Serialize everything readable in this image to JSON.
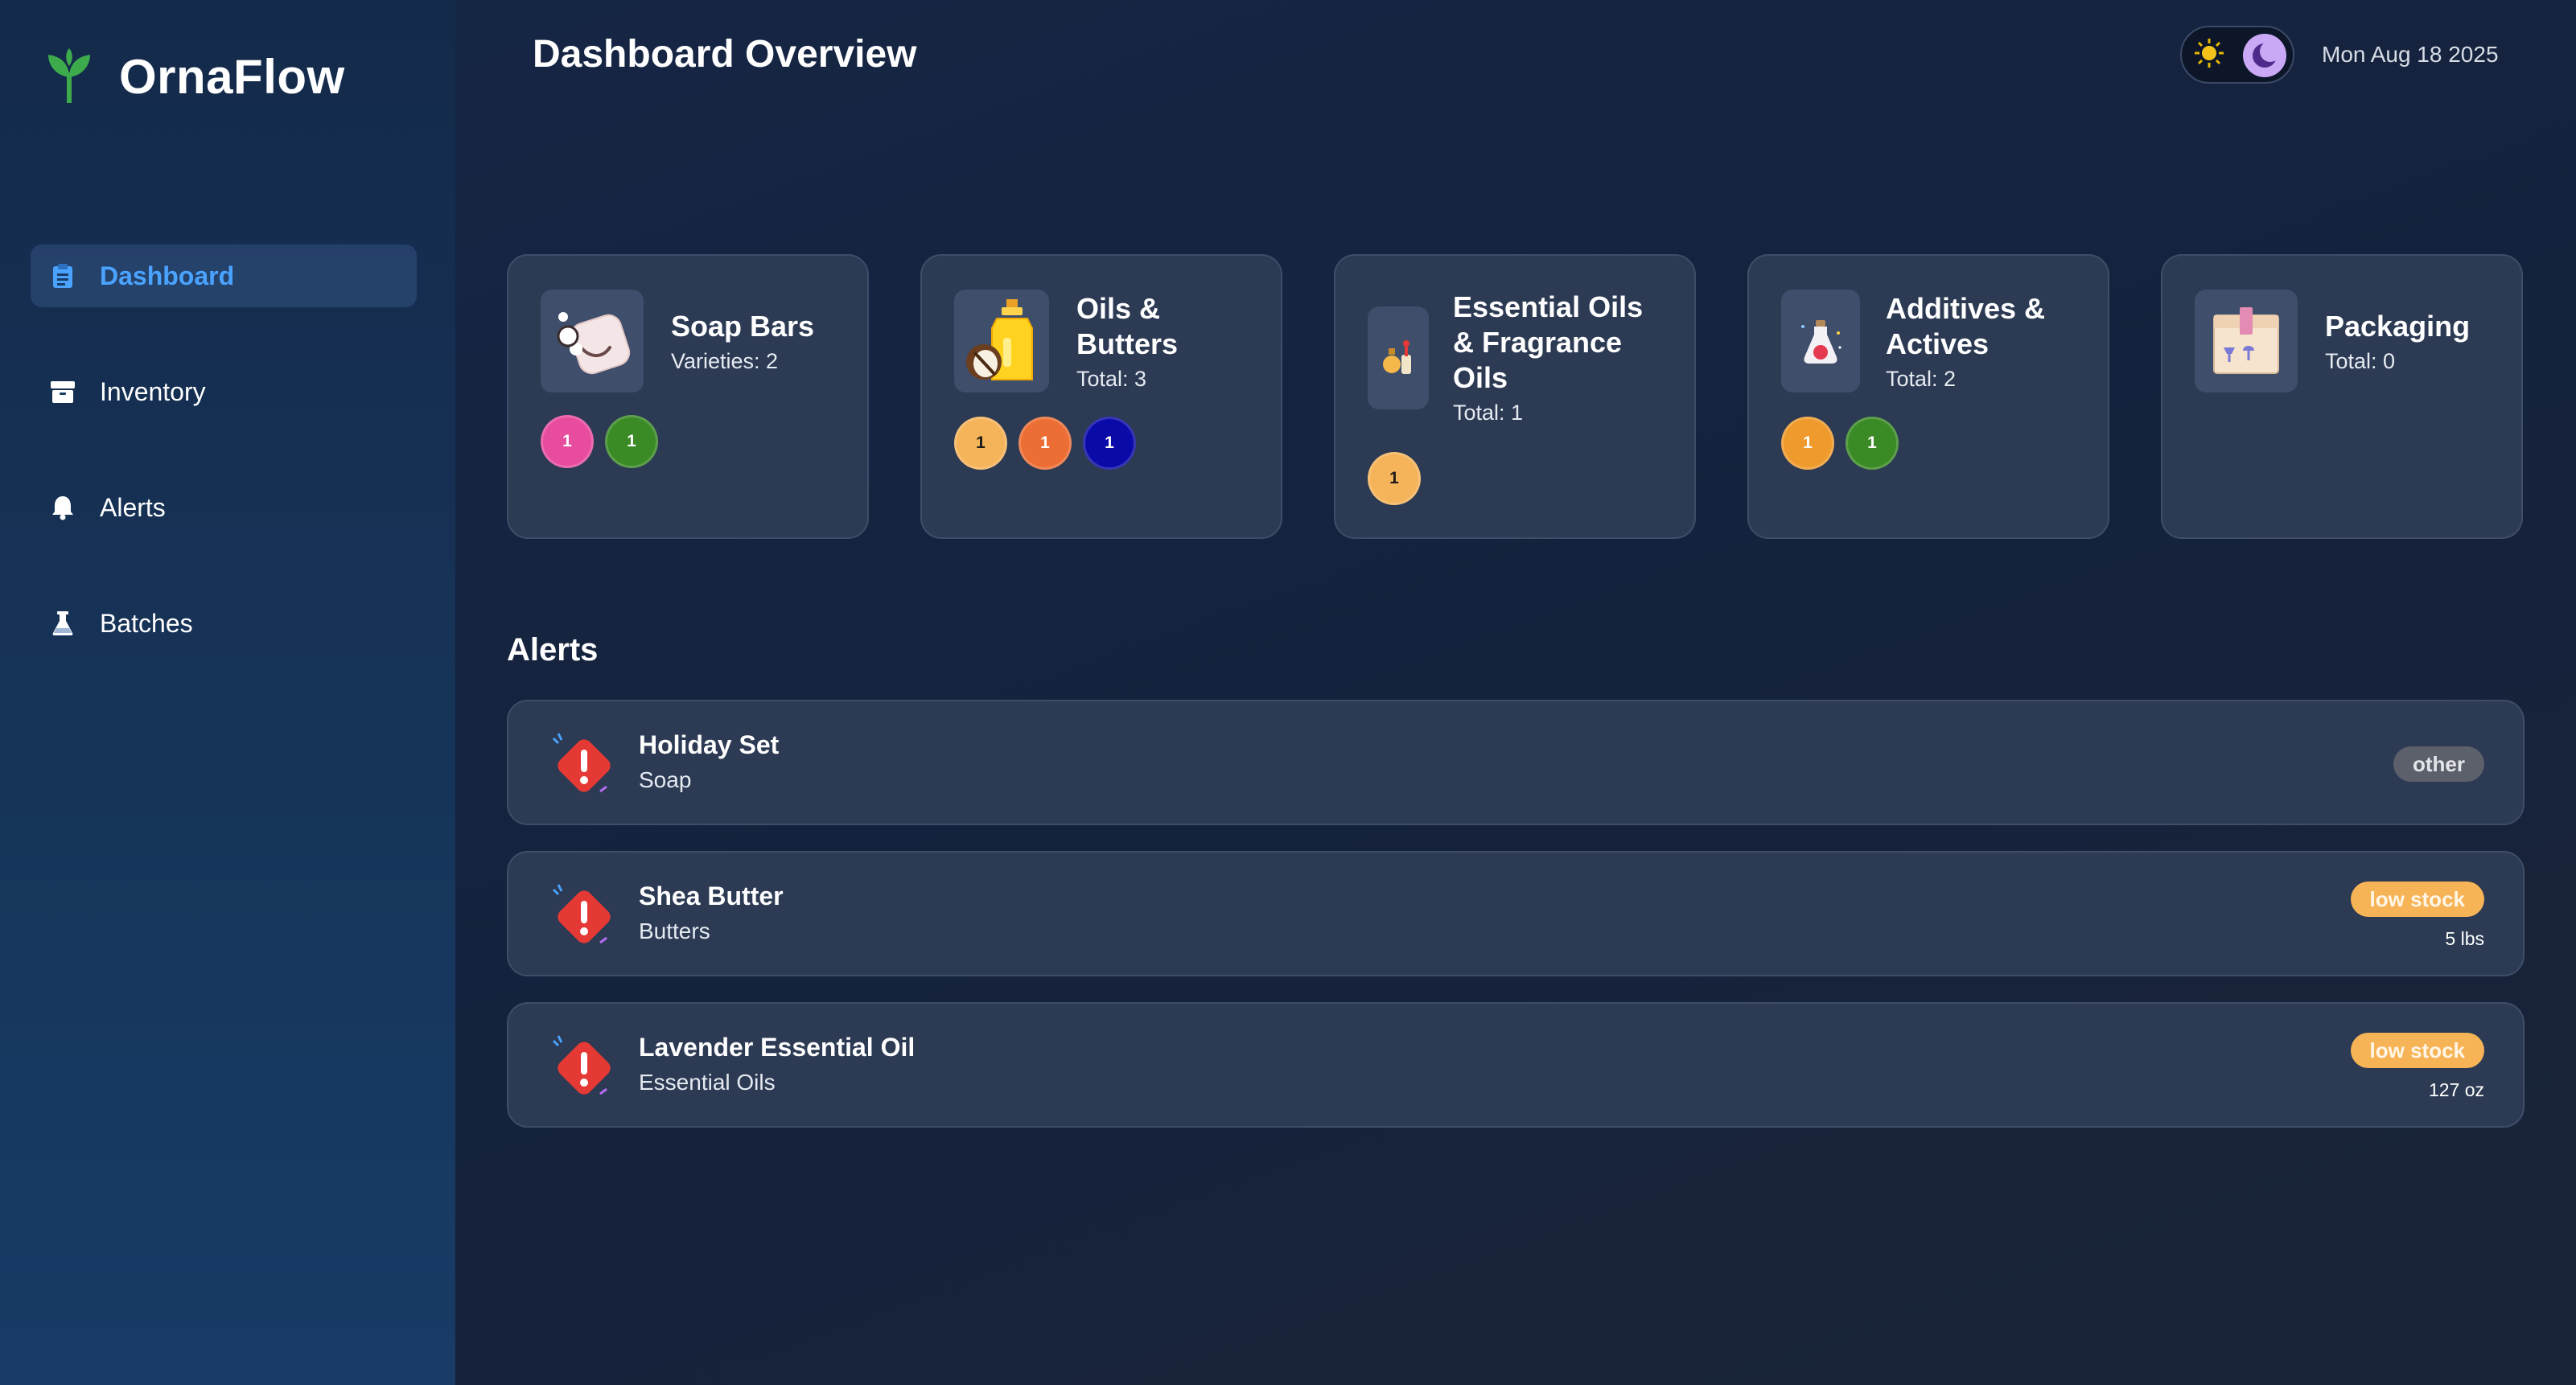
{
  "app": {
    "name": "OrnaFlow"
  },
  "nav": {
    "items": [
      {
        "label": "Dashboard",
        "icon": "clipboard-icon",
        "active": true
      },
      {
        "label": "Inventory",
        "icon": "box-icon",
        "active": false
      },
      {
        "label": "Alerts",
        "icon": "bell-icon",
        "active": false
      },
      {
        "label": "Batches",
        "icon": "flask-icon",
        "active": false
      }
    ]
  },
  "header": {
    "title": "Dashboard Overview",
    "date": "Mon Aug 18 2025",
    "theme": "dark"
  },
  "categories": [
    {
      "title": "Soap Bars",
      "sub": "Varieties: 2",
      "icon": "soap-icon",
      "badges": [
        {
          "value": "1",
          "color": "#e84c9e"
        },
        {
          "value": "1",
          "color": "#3a8a25"
        }
      ]
    },
    {
      "title": "Oils & Butters",
      "sub": "Total: 3",
      "icon": "oil-bottle-coconut-icon",
      "badges": [
        {
          "value": "1",
          "color": "#f5b459"
        },
        {
          "value": "1",
          "color": "#ec6e34"
        },
        {
          "value": "1",
          "color": "#0a0aa8"
        }
      ]
    },
    {
      "title": "Essential Oils & Fragrance Oils",
      "sub": "Total: 1",
      "icon": "perfume-icon",
      "badges": [
        {
          "value": "1",
          "color": "#f5b459"
        }
      ]
    },
    {
      "title": "Additives & Actives",
      "sub": "Total: 2",
      "icon": "potion-icon",
      "badges": [
        {
          "value": "1",
          "color": "#ef9a2c"
        },
        {
          "value": "1",
          "color": "#3a8a25"
        }
      ]
    },
    {
      "title": "Packaging",
      "sub": "Total: 0",
      "icon": "package-box-icon",
      "badges": []
    }
  ],
  "alerts": {
    "title": "Alerts",
    "items": [
      {
        "name": "Holiday Set",
        "category": "Soap",
        "status": "other",
        "qty": ""
      },
      {
        "name": "Shea Butter",
        "category": "Butters",
        "status": "low stock",
        "qty": "5 lbs"
      },
      {
        "name": "Lavender Essential Oil",
        "category": "Essential Oils",
        "status": "low stock",
        "qty": "127 oz"
      }
    ]
  },
  "colors": {
    "accent": "#4aa3ff",
    "brand_leaf": "#3daa4c",
    "alert_red": "#e53935",
    "low_stock": "#f7b457",
    "other_status": "#5b606a"
  }
}
